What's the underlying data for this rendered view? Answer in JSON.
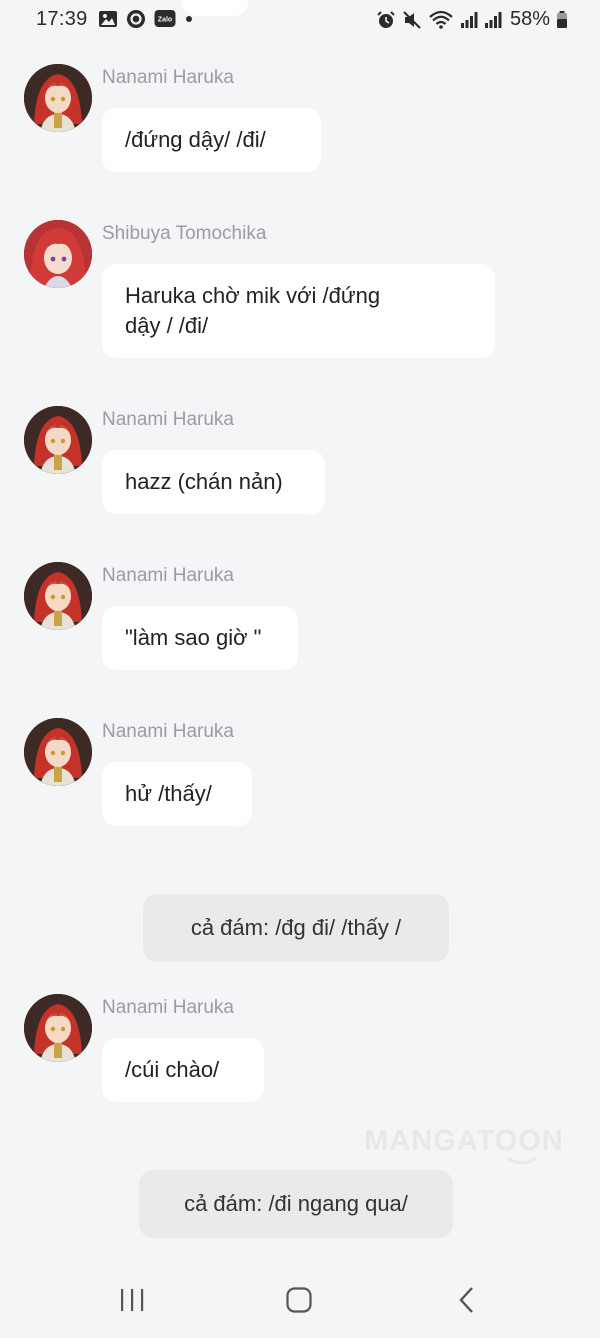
{
  "status_bar": {
    "time": "17:39",
    "zalo_label": "Zalo",
    "battery_percent": "58%",
    "left_icons": [
      "gallery-icon",
      "messenger-icon",
      "zalo-icon",
      "dot-icon"
    ],
    "right_icons": [
      "alarm-icon",
      "mute-icon",
      "wifi-icon",
      "signal-icon",
      "signal-icon",
      "battery-icon"
    ]
  },
  "messages": [
    {
      "sender": "Nanami Haruka",
      "text": "/đứng dậy/ /đi/",
      "avatar": "haruka-avatar"
    },
    {
      "sender": "Shibuya Tomochika",
      "text_lines": [
        "Haruka chờ mik với /đứng",
        "dậy / /đi/"
      ],
      "avatar": "tomochika-avatar"
    },
    {
      "sender": "Nanami Haruka",
      "text": "hazz (chán nản)",
      "avatar": "haruka-avatar"
    },
    {
      "sender": "Nanami Haruka",
      "text": "\"làm sao giờ \"",
      "avatar": "haruka-avatar"
    },
    {
      "sender": "Nanami Haruka",
      "text": "hử /thấy/",
      "avatar": "haruka-avatar"
    },
    {
      "narration": "cả đám: /đg đi/ /thấy /"
    },
    {
      "sender": "Nanami Haruka",
      "text": "/cúi chào/",
      "avatar": "haruka-avatar"
    },
    {
      "narration": "cả đám: /đi ngang qua/"
    }
  ],
  "watermark": "MANGATOON",
  "nav_bar": {
    "buttons": [
      "recent-apps-icon",
      "home-icon",
      "back-icon"
    ]
  },
  "colors": {
    "background": "#f4f5f7",
    "bubble": "#ffffff",
    "narration_bubble": "#e9eaeb",
    "sender_name": "#9a9ca1",
    "avatar_hair": "#c4322a"
  }
}
